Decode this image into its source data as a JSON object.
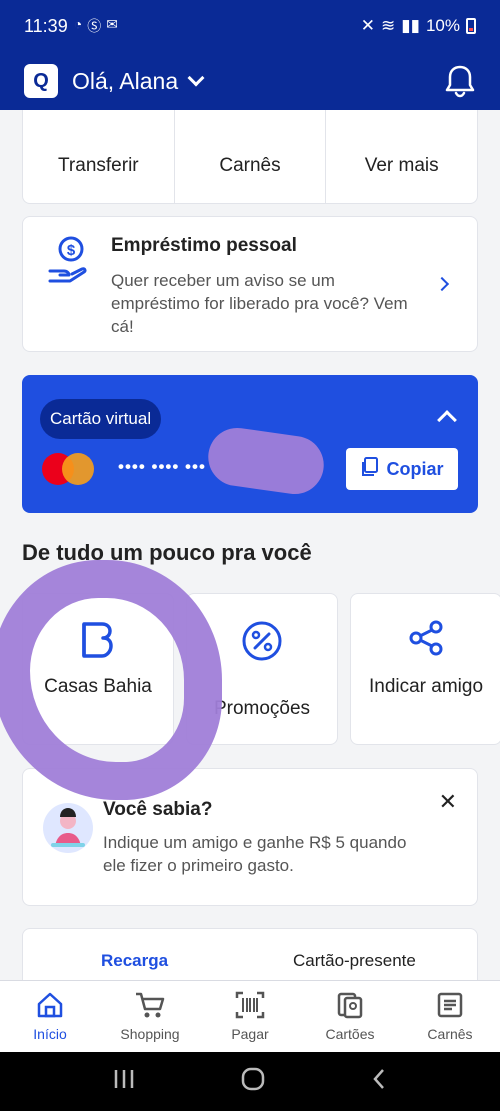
{
  "status_bar": {
    "time": "11:39",
    "notification_icons": [
      "whatsapp-icon",
      "dollar-icon",
      "mail-icon"
    ],
    "battery": "10%"
  },
  "header": {
    "logo": "Q",
    "greeting": "Olá, Alana"
  },
  "quick_actions": [
    {
      "label": "Transferir"
    },
    {
      "label": "Carnês"
    },
    {
      "label": "Ver mais"
    }
  ],
  "loan_card": {
    "title": "Empréstimo pessoal",
    "body": "Quer receber um aviso se um empréstimo for liberado pra você? Vem cá!"
  },
  "virtual_card": {
    "label": "Cartão virtual",
    "number_masked": "•••• •••• •••",
    "copy_label": "Copiar"
  },
  "section": {
    "title": "De tudo um pouco pra você"
  },
  "tiles": [
    {
      "label": "Casas Bahia"
    },
    {
      "label": "Promoções"
    },
    {
      "label": "Indicar amigo"
    }
  ],
  "tip_card": {
    "title": "Você sabia?",
    "body": "Indique um amigo e ganhe R$ 5 quando ele fizer o primeiro gasto."
  },
  "recharge_tabs": [
    {
      "label": "Recarga"
    },
    {
      "label": "Cartão-presente"
    }
  ],
  "bottom_nav": [
    {
      "label": "Início",
      "active": true
    },
    {
      "label": "Shopping"
    },
    {
      "label": "Pagar"
    },
    {
      "label": "Cartões"
    },
    {
      "label": "Carnês"
    }
  ],
  "colors": {
    "header_bg": "#0a2a96",
    "accent": "#1f4fe0",
    "annotation": "#a07ed8"
  }
}
